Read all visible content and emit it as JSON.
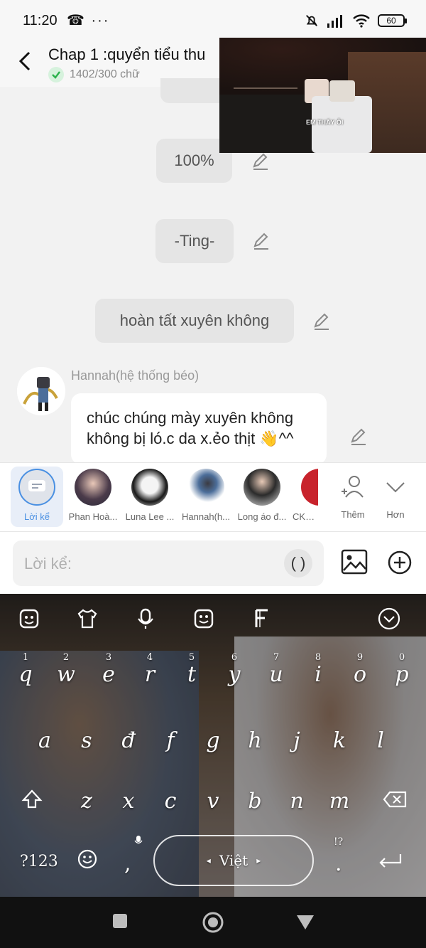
{
  "status_bar": {
    "time": "11:20",
    "left_icons": [
      "phone-missed-icon",
      "more-dots-icon"
    ],
    "battery": "60"
  },
  "header": {
    "title": "Chap 1 :quyển tiểu thu",
    "word_count": "1402/300 chữ"
  },
  "video_overlay": {
    "caption": "EM THẤY ÔI"
  },
  "messages": [
    {
      "text": "100%"
    },
    {
      "text": "-Ting-"
    },
    {
      "text": "hoàn tất xuyên không"
    }
  ],
  "character_message": {
    "sender": "Hannah(hệ thống béo)",
    "text": "chúc chúng mày xuyên không không bị ló.c da x.ẻo thịt 👋^^"
  },
  "characters": [
    {
      "label": "Lời kể",
      "active": true
    },
    {
      "label": "Phan Hoà..."
    },
    {
      "label": "Luna Lee ..."
    },
    {
      "label": "Hannah(h..."
    },
    {
      "label": "Long áo đ..."
    },
    {
      "label": "CKG ("
    }
  ],
  "char_actions": {
    "more_label": "Thêm",
    "expand_label": "Hơn"
  },
  "input": {
    "placeholder": "Lời kể:",
    "paren_label": "( )"
  },
  "keyboard": {
    "row1": [
      "q",
      "w",
      "e",
      "r",
      "t",
      "y",
      "u",
      "i",
      "o",
      "p"
    ],
    "row1_numbers": [
      "1",
      "2",
      "3",
      "4",
      "5",
      "6",
      "7",
      "8",
      "9",
      "0"
    ],
    "row2": [
      "a",
      "s",
      "đ",
      "f",
      "g",
      "h",
      "j",
      "k",
      "l"
    ],
    "row3": [
      "z",
      "x",
      "c",
      "v",
      "b",
      "n",
      "m"
    ],
    "symbols_label": "?123",
    "comma": ",",
    "period": ".",
    "punct_hint": "!?",
    "space_label": "Việt"
  },
  "colors": {
    "accent_blue": "#4a90e2",
    "check_green": "#2bb24c"
  }
}
